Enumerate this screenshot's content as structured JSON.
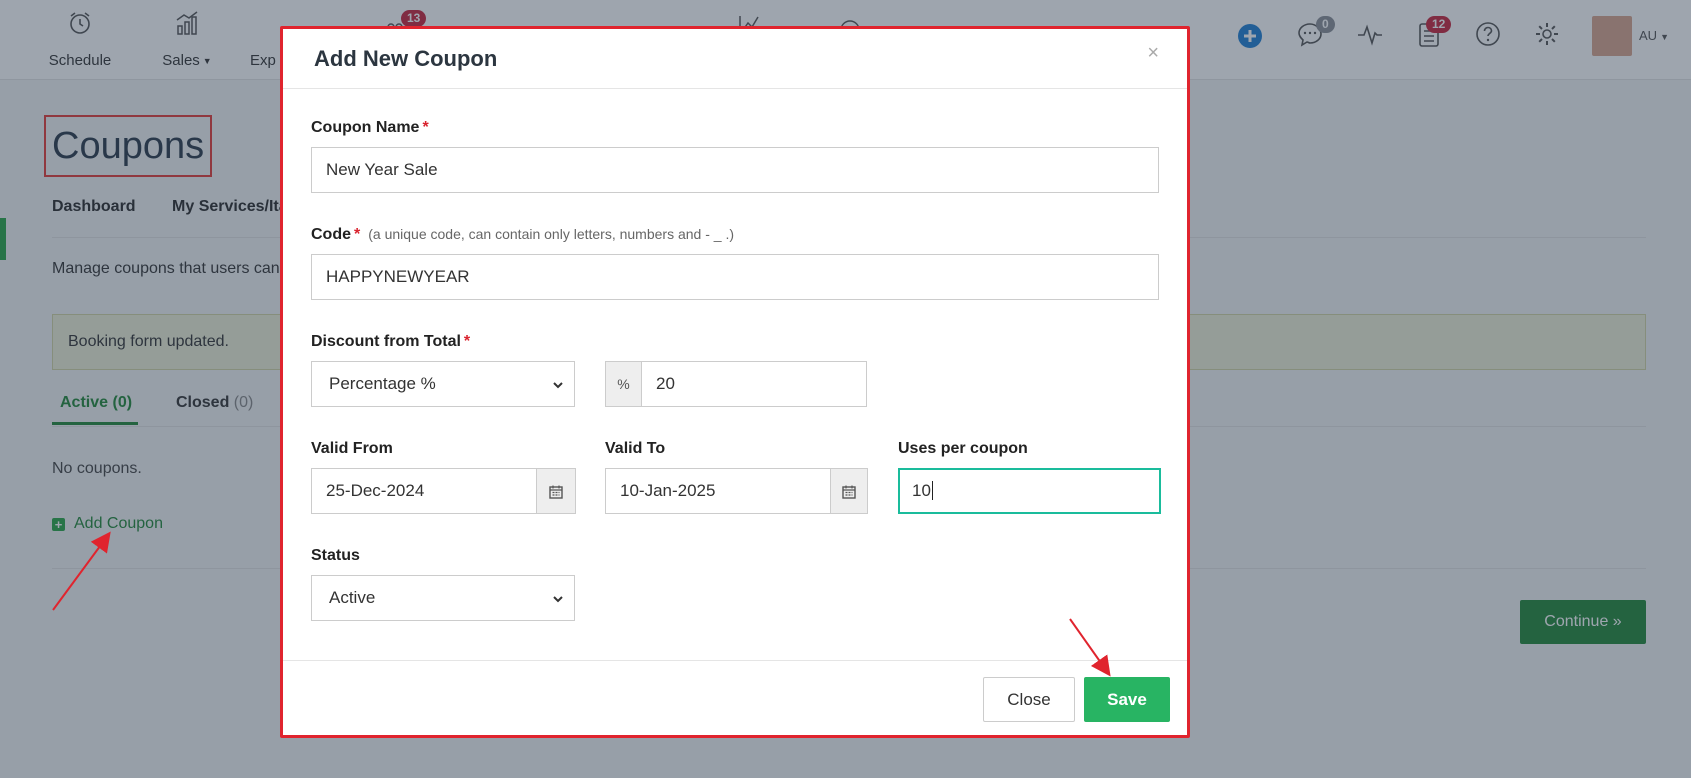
{
  "nav": {
    "items": [
      {
        "label": "Schedule",
        "icon": "alarm-clock-icon"
      },
      {
        "label": "Sales",
        "icon": "bar-chart-coins-icon",
        "has_caret": true
      },
      {
        "label": "Exp",
        "icon": "expenses-icon"
      },
      {
        "label": "",
        "icon": "users-icon",
        "badge": "13"
      },
      {
        "label": "",
        "icon": "megaphone-icon"
      },
      {
        "label": "",
        "icon": "store-icon"
      },
      {
        "label": "",
        "icon": "line-chart-icon"
      },
      {
        "label": "",
        "icon": "smile-icon"
      }
    ],
    "right": {
      "chat_badge": "0",
      "tasks_badge": "12",
      "avatar_label": "AU"
    }
  },
  "page": {
    "title": "Coupons",
    "subnav": [
      "Dashboard",
      "My Services/Ita"
    ],
    "description": "Manage coupons that users can",
    "alert": "Booking form updated.",
    "tabs": [
      {
        "label": "Active",
        "count": "(0)"
      },
      {
        "label": "Closed",
        "count": "(0)"
      }
    ],
    "empty_text": "No coupons.",
    "add_coupon": "Add Coupon",
    "continue_btn": "Continue »"
  },
  "modal": {
    "title": "Add New Coupon",
    "close_x": "×",
    "coupon_name": {
      "label": "Coupon Name",
      "required": "*",
      "value": "New Year Sale"
    },
    "code": {
      "label": "Code",
      "required": "*",
      "hint": "(a unique code, can contain only letters, numbers and - _ .)",
      "value": "HAPPYNEWYEAR"
    },
    "discount": {
      "label": "Discount from Total",
      "required": "*",
      "type_value": "Percentage %",
      "addon": "%",
      "amount": "20"
    },
    "valid_from": {
      "label": "Valid From",
      "value": "25-Dec-2024"
    },
    "valid_to": {
      "label": "Valid To",
      "value": "10-Jan-2025"
    },
    "uses": {
      "label": "Uses per coupon",
      "value": "10"
    },
    "status": {
      "label": "Status",
      "value": "Active"
    },
    "btn_close": "Close",
    "btn_save": "Save"
  },
  "colors": {
    "accent_green": "#28b463",
    "highlight_red": "#e0242e",
    "badge_red": "#c9243b",
    "focus_teal": "#1abc9c"
  }
}
